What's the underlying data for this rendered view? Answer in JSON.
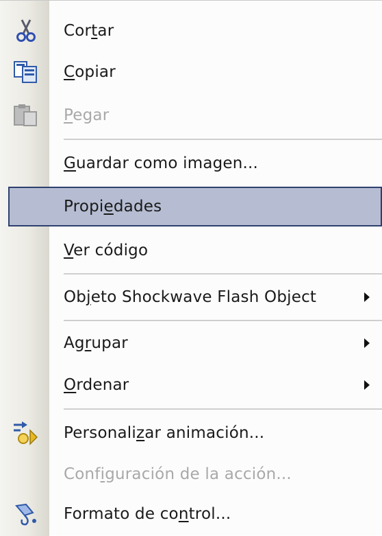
{
  "context_menu": {
    "items": [
      {
        "pre": "Cor",
        "acc": "t",
        "post": "ar",
        "icon": "scissors-icon",
        "enabled": true
      },
      {
        "pre": "",
        "acc": "C",
        "post": "opiar",
        "icon": "copy-icon",
        "enabled": true
      },
      {
        "pre": "",
        "acc": "P",
        "post": "egar",
        "icon": "paste-icon",
        "enabled": false
      },
      {
        "pre": "",
        "acc": "G",
        "post": "uardar como imagen...",
        "enabled": true
      },
      {
        "pre": "Propi",
        "acc": "e",
        "post": "dades",
        "enabled": true,
        "highlighted": true
      },
      {
        "pre": "",
        "acc": "V",
        "post": "er código",
        "enabled": true
      },
      {
        "pre": "Ob",
        "acc": "j",
        "post": "eto Shockwave Flash Object",
        "enabled": true,
        "submenu": true
      },
      {
        "pre": "Ag",
        "acc": "r",
        "post": "upar",
        "enabled": true,
        "submenu": true
      },
      {
        "pre": "",
        "acc": "O",
        "post": "rdenar",
        "enabled": true,
        "submenu": true
      },
      {
        "pre": "Personali",
        "acc": "z",
        "post": "ar animación...",
        "icon": "custom-animation-icon",
        "enabled": true
      },
      {
        "pre": "Conf",
        "acc": "i",
        "post": "guración de la acción...",
        "enabled": false
      },
      {
        "pre": "Formato de co",
        "acc": "n",
        "post": "trol...",
        "icon": "format-control-icon",
        "enabled": true
      }
    ]
  }
}
